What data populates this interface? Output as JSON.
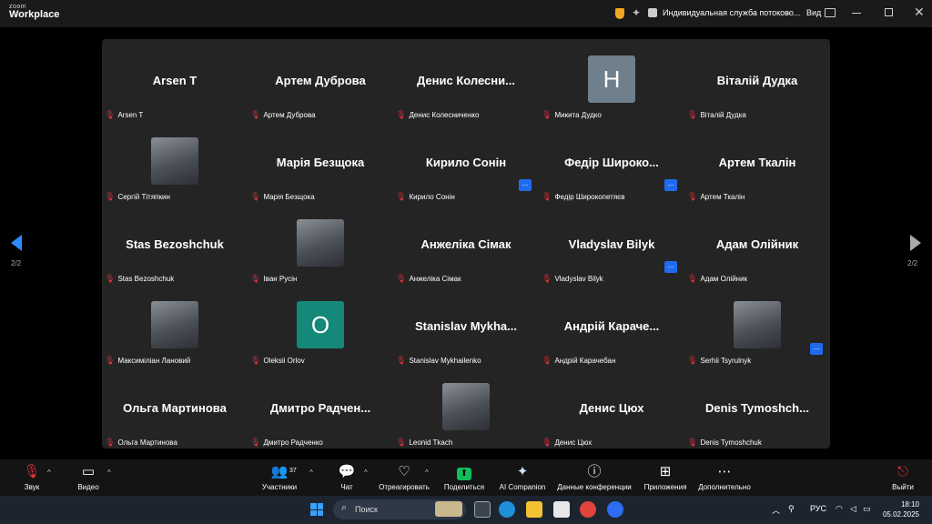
{
  "titlebar": {
    "logo_small": "zoom",
    "logo_big": "Workplace",
    "meeting_title": "Индивидуальная служба потоково...",
    "view_label": "Вид"
  },
  "gallery": {
    "tiles": [
      {
        "name": "Arsen T",
        "label": "Arsen T"
      },
      {
        "name": "Артем Дуброва",
        "label": "Артем Дуброва"
      },
      {
        "name": "Денис  Колесни...",
        "label": "Денис Колесниченко"
      },
      {
        "name": "",
        "label": "Микита Дудко",
        "avatar_letter": "H",
        "avatar_color": "#6f7f8b"
      },
      {
        "name": "Віталій Дудка",
        "label": "Віталій Дудка"
      },
      {
        "name": "",
        "label": "Сергій Тітяпкин",
        "avatar_photo": true
      },
      {
        "name": "Марія Безщока",
        "label": "Марія Безщока"
      },
      {
        "name": "Кирило Сонін",
        "label": "Кирило Сонін",
        "more": "..."
      },
      {
        "name": "Федір  Широко...",
        "label": "Федір Широкопетяєв",
        "more": "..."
      },
      {
        "name": "Артем Ткалін",
        "label": "Артем Ткалін"
      },
      {
        "name": "Stas Bezoshchuk",
        "label": "Stas Bezoshchuk"
      },
      {
        "name": "",
        "label": "Іван Русін",
        "avatar_photo": true
      },
      {
        "name": "Анжеліка Сімак",
        "label": "Анжеліка Сімак"
      },
      {
        "name": "Vladyslav Bilyk",
        "label": "Vladyslav Bilyk",
        "more": "..."
      },
      {
        "name": "Адам Олійник",
        "label": "Адам Олійник"
      },
      {
        "name": "",
        "label": "Максиміліан Лановий",
        "avatar_photo": true
      },
      {
        "name": "",
        "label": "Oleksii Orlov",
        "avatar_letter": "O",
        "avatar_color": "#14897a"
      },
      {
        "name": "Stanislav  Mykha...",
        "label": "Stanislav Mykhailenko"
      },
      {
        "name": "Андрій  Караче...",
        "label": "Андрій Карачебан"
      },
      {
        "name": "",
        "label": "Serhii Tsyrulnyk",
        "avatar_photo": true,
        "more": "..."
      },
      {
        "name": "Ольга Мартинова",
        "label": "Ольга Мартинова"
      },
      {
        "name": "Дмитро  Радчен...",
        "label": "Дмитро Радченко"
      },
      {
        "name": "",
        "label": "Leonid Tkach",
        "avatar_photo": true
      },
      {
        "name": "Денис Цюх",
        "label": "Денис Цюх"
      },
      {
        "name": "Denis  Tymoshch...",
        "label": "Denis Tymoshchuk"
      }
    ]
  },
  "pagination": {
    "left": "2/2",
    "right": "2/2"
  },
  "toolbar": {
    "audio": "Звук",
    "video": "Видео",
    "participants": "Участники",
    "participants_count": "37",
    "chat": "Чат",
    "react": "Отреагировать",
    "share": "Поделиться",
    "ai": "AI Companion",
    "info": "Данные конференции",
    "apps": "Приложения",
    "more": "Дополнительно",
    "leave": "Выйти"
  },
  "taskbar": {
    "search": "Поиск",
    "lang": "РУС",
    "time": "18:10",
    "date": "05.02.2025"
  },
  "colors": {
    "accent": "#1f6bf0",
    "mic_muted": "#e0333c",
    "share_green": "#0fbf5a"
  }
}
